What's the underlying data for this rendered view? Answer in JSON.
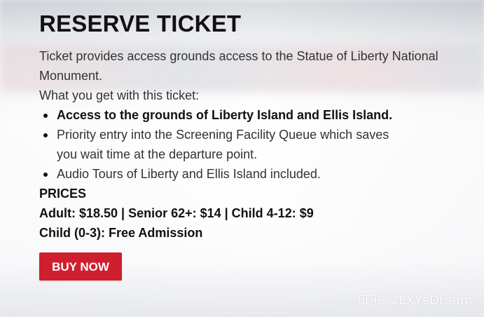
{
  "heading": "RESERVE TICKET",
  "description": "Ticket provides access grounds access to the Statue of Liberty National Monument.",
  "intro": "What you get with this ticket:",
  "features": [
    "Access to the grounds of Liberty Island and Ellis Island.",
    "Priority entry into the Screening Facility Queue which saves you wait time at the departure point.",
    "Audio Tours of Liberty and Ellis Island included."
  ],
  "prices": {
    "heading": "PRICES",
    "line1": "Adult: $18.50 | Senior 62+: $14 | Child 4-12: $9",
    "line2": "Child (0-3): Free Admission"
  },
  "buy_button": "BUY NOW",
  "watermark": "知乎 @LXYsDream",
  "colors": {
    "button": "#cf1f2e",
    "heading": "#111111",
    "body_text": "#333333"
  }
}
